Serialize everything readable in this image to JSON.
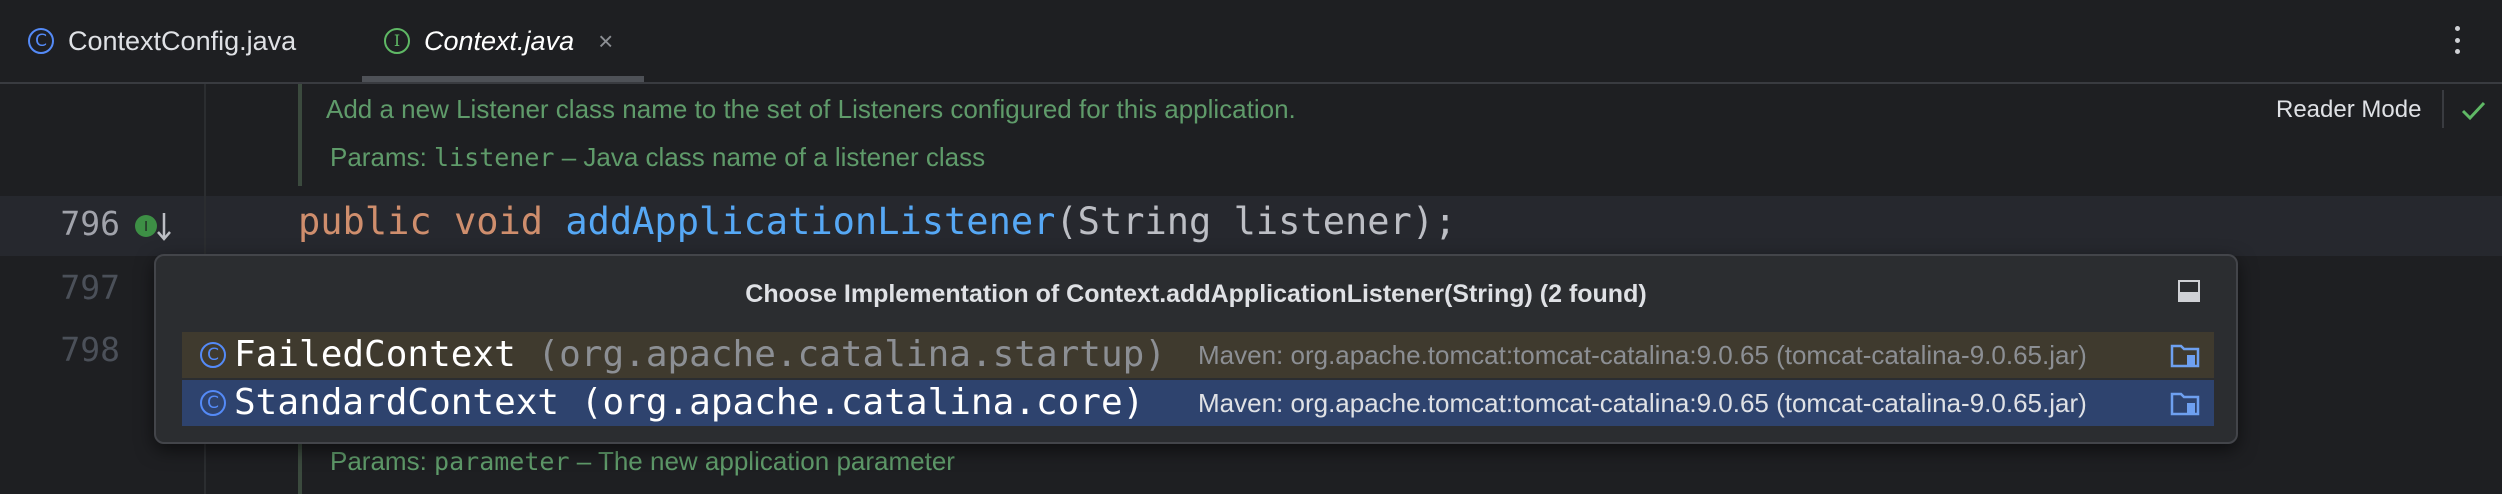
{
  "tabs": [
    {
      "label": "ContextConfig.java",
      "icon": "class-icon",
      "glyph": "C"
    },
    {
      "label": "Context.java",
      "icon": "interface-icon",
      "glyph": "I",
      "active": true
    }
  ],
  "tab_close_glyph": "×",
  "reader_mode": "Reader Mode",
  "doc_top": {
    "description": "Add a new Listener class name to the set of Listeners configured for this application.",
    "params_label": "Params:",
    "param_name": "listener",
    "param_desc": "– Java class name of a listener class"
  },
  "doc_bottom": {
    "params_label": "Params:",
    "param_name": "parameter",
    "param_desc": "– The new application parameter"
  },
  "editor": {
    "line_numbers": [
      "796",
      "797",
      "798"
    ],
    "code": {
      "kw1": "public",
      "kw2": "void",
      "method": "addApplicationListener",
      "rest": "(String listener);"
    }
  },
  "popup": {
    "title": "Choose Implementation of Context.addApplicationListener(String) (2 found)",
    "items": [
      {
        "class": "FailedContext",
        "package": "(org.apache.catalina.startup)",
        "location": "Maven: org.apache.tomcat:tomcat-catalina:9.0.65 (tomcat-catalina-9.0.65.jar)",
        "icon": "class-icon",
        "glyph": "C"
      },
      {
        "class": "StandardContext",
        "package": "(org.apache.catalina.core)",
        "location": "Maven: org.apache.tomcat:tomcat-catalina:9.0.65 (tomcat-catalina-9.0.65.jar)",
        "icon": "class-icon",
        "glyph": "C",
        "selected": true
      }
    ]
  },
  "colors": {
    "background": "#1e1f22",
    "keyword": "#cf8e6d",
    "method": "#56a8f5",
    "doc_comment": "#5f9b6a",
    "selection": "#2e436e"
  }
}
